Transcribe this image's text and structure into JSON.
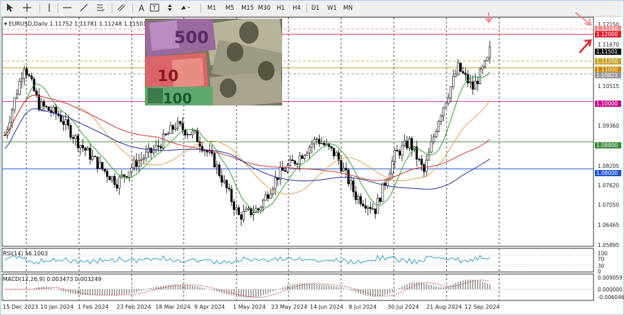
{
  "toolbar": {
    "timeframes": [
      "M1",
      "M5",
      "M15",
      "M30",
      "H1",
      "H4",
      "D1",
      "W1",
      "MN"
    ]
  },
  "chart": {
    "title": "EURUSD,Daily  1.11752 1.11781 1.11248 1.11501",
    "y_ticks": [
      "1.12150",
      "1.11670",
      "1.11190",
      "1.10515",
      "1.09840",
      "1.09360",
      "1.08820",
      "1.08205",
      "1.07620",
      "1.07050",
      "1.06465",
      "1.05895"
    ],
    "price_boxes": [
      {
        "label": "1.12150",
        "color": "#f08a8a"
      },
      {
        "label": "1.12000",
        "color": "#e0202b"
      },
      {
        "label": "1.11501",
        "color": "#111111"
      },
      {
        "label": "1.11200",
        "color": "#c9a227"
      },
      {
        "label": "1.11000",
        "color": "#c88a00"
      },
      {
        "label": "1.10821",
        "color": "#9a9a9a"
      },
      {
        "label": "1.10000",
        "color": "#c0108a"
      },
      {
        "label": "1.08800",
        "color": "#3a8a3a"
      },
      {
        "label": "1.08000",
        "color": "#2255cc"
      }
    ],
    "x_labels": [
      "15 Dec 2023",
      "10 Jan 2024",
      "1 Feb 2024",
      "23 Feb 2024",
      "18 Mar 2024",
      "9 Apr 2024",
      "1 May 2024",
      "23 May 2024",
      "14 Jun 2024",
      "8 Jul 2024",
      "30 Jul 2024",
      "21 Aug 2024",
      "12 Sep 2024"
    ]
  },
  "rsi": {
    "title": "RSI(14) 56.1003",
    "ticks": [
      "100",
      "70",
      "30",
      "0"
    ]
  },
  "macd": {
    "title": "MACD(12,26,9) 0.003473 0.003249",
    "ticks": [
      "0.009059",
      "0.000000",
      "-0.006046"
    ]
  },
  "photo": {
    "note_500": "500",
    "note_10": "10",
    "note_100": "100"
  },
  "colors": {
    "bull": "#ffffff",
    "bear": "#000000",
    "ma_green": "#2ea02e",
    "ma_orange": "#e0a050",
    "ma_blue": "#1d2a9a",
    "ma_red": "#c8322a"
  }
}
